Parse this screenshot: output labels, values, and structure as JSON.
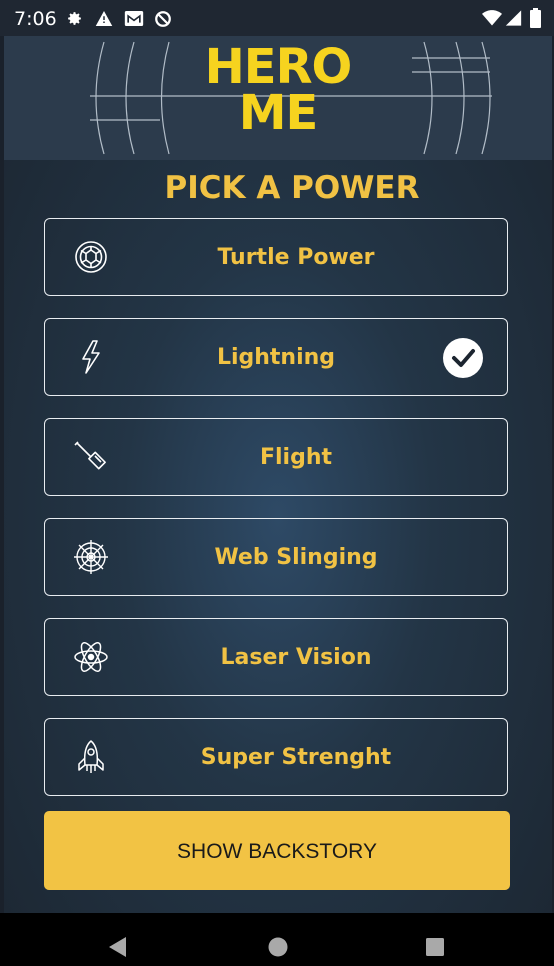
{
  "status_bar": {
    "time": "7:06"
  },
  "header": {
    "logo_line1": "HERO",
    "logo_line2": "ME"
  },
  "section_title": "PICK A POWER",
  "powers": [
    {
      "label": "Turtle Power",
      "icon": "turtle-shell-icon",
      "selected": false
    },
    {
      "label": "Lightning",
      "icon": "lightning-bolt-icon",
      "selected": true
    },
    {
      "label": "Flight",
      "icon": "hammer-icon",
      "selected": false
    },
    {
      "label": "Web Slinging",
      "icon": "spider-web-icon",
      "selected": false
    },
    {
      "label": "Laser Vision",
      "icon": "atom-icon",
      "selected": false
    },
    {
      "label": "Super Strenght",
      "icon": "rocket-icon",
      "selected": false
    }
  ],
  "cta_label": "SHOW BACKSTORY",
  "colors": {
    "accent": "#f1c244",
    "cta": "#f2c344",
    "logo": "#f6d31f",
    "header_bg": "#2c3b4c"
  }
}
